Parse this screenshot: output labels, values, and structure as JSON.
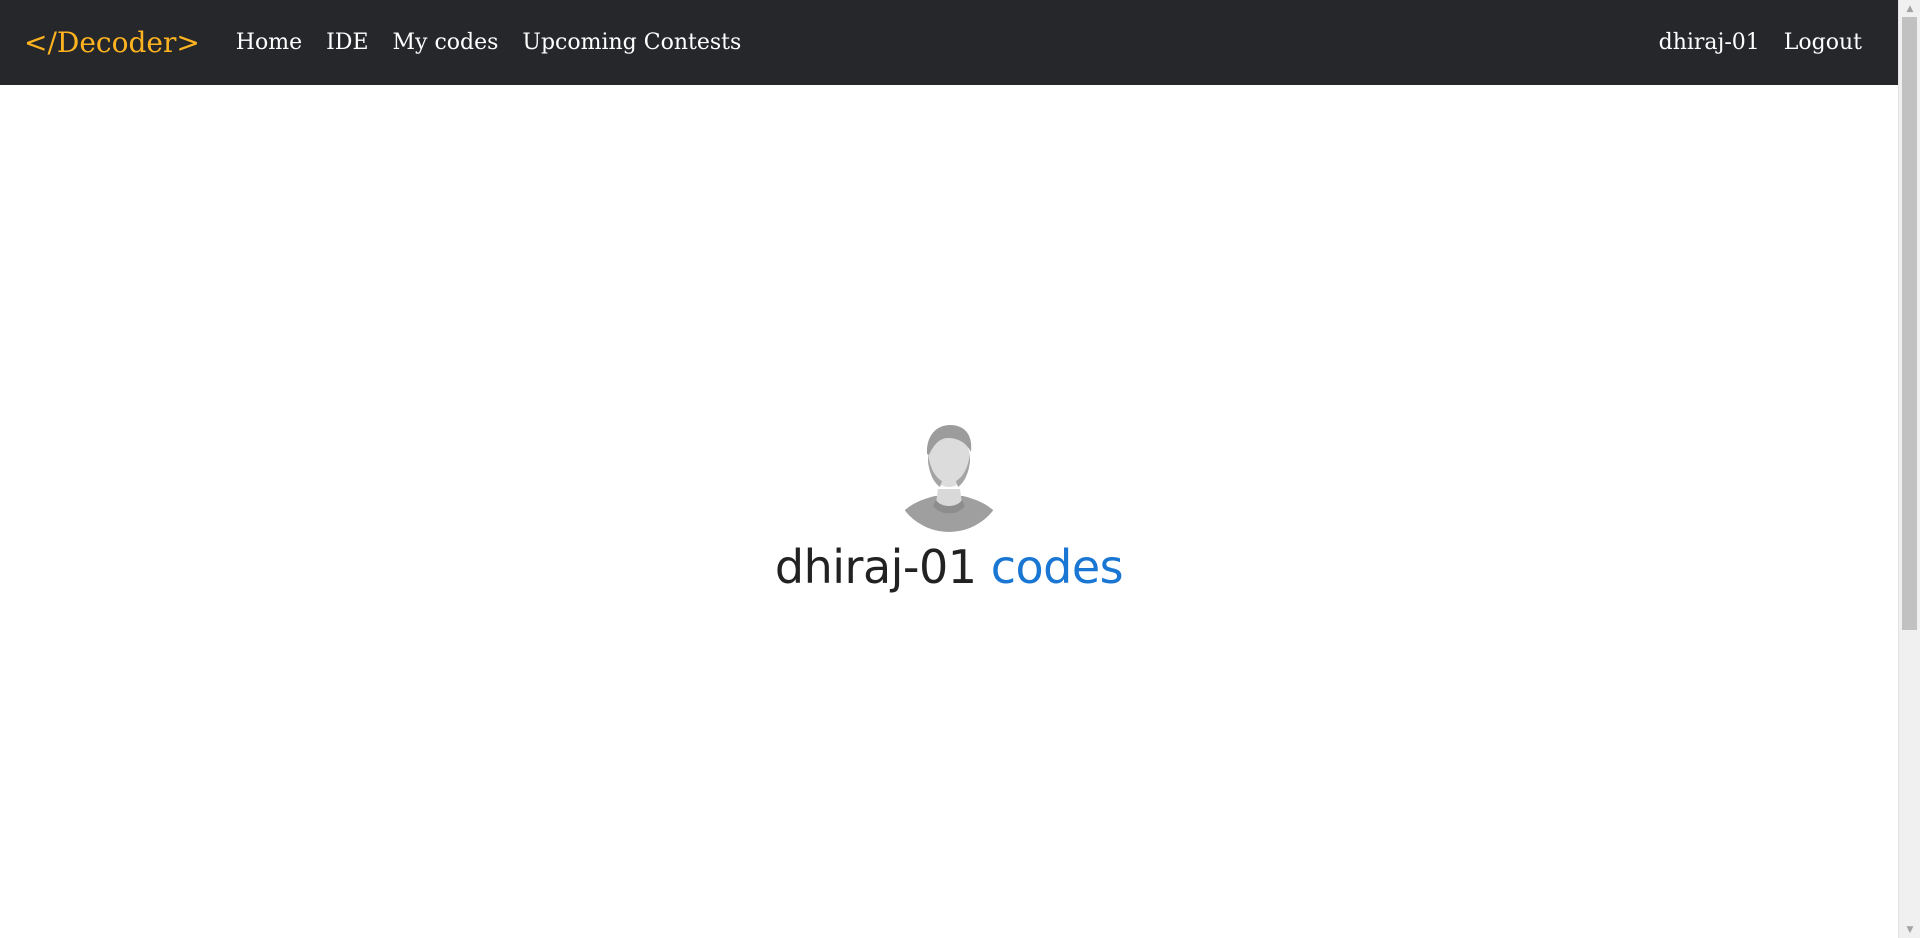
{
  "navbar": {
    "brand": "</Decoder>",
    "links": [
      {
        "label": "Home"
      },
      {
        "label": "IDE"
      },
      {
        "label": "My codes"
      },
      {
        "label": "Upcoming Contests"
      }
    ],
    "user": "dhiraj-01",
    "logout": "Logout"
  },
  "profile": {
    "username": "dhiraj-01",
    "suffix": "codes",
    "avatar_icon": "user-silhouette-icon"
  },
  "colors": {
    "navbar_bg": "#25272b",
    "brand": "#ffb41f",
    "accent": "#1976d2",
    "text_dark": "#222222"
  }
}
